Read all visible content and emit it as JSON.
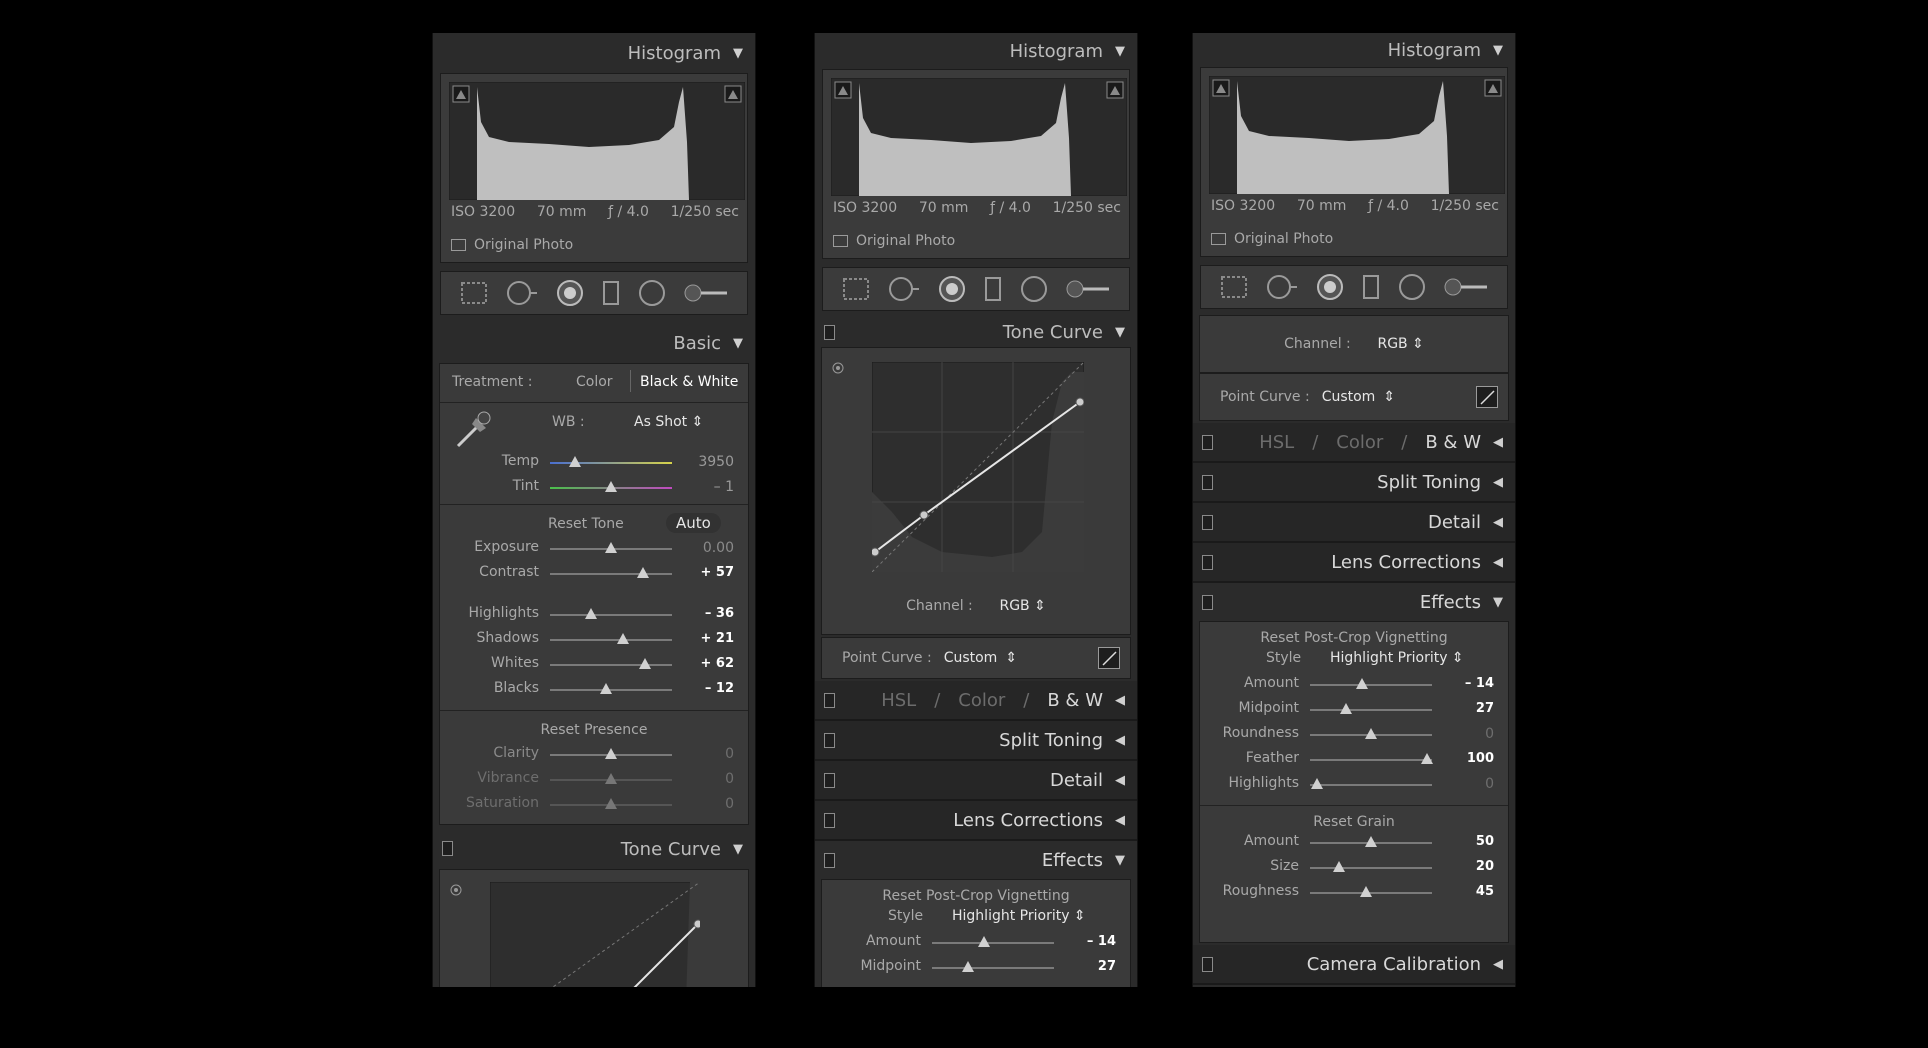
{
  "histogram": {
    "title": "Histogram",
    "iso": "ISO 3200",
    "focal": "70 mm",
    "aperture": "ƒ / 4.0",
    "shutter": "1/250 sec",
    "original": "Original Photo"
  },
  "basic": {
    "title": "Basic",
    "treatment_label": "Treatment :",
    "treatment_color": "Color",
    "treatment_bw": "Black & White",
    "wb_label": "WB :",
    "wb_value": "As Shot",
    "temp": {
      "label": "Temp",
      "value": "3950",
      "pos": 0.23
    },
    "tint": {
      "label": "Tint",
      "value": "– 1",
      "pos": 0.5
    },
    "reset_tone": "Reset Tone",
    "auto": "Auto",
    "exposure": {
      "label": "Exposure",
      "value": "0.00",
      "pos": 0.5
    },
    "contrast": {
      "label": "Contrast",
      "value": "+ 57",
      "pos": 0.76
    },
    "highlights": {
      "label": "Highlights",
      "value": "– 36",
      "pos": 0.34
    },
    "shadows": {
      "label": "Shadows",
      "value": "+ 21",
      "pos": 0.6
    },
    "whites": {
      "label": "Whites",
      "value": "+ 62",
      "pos": 0.78
    },
    "blacks": {
      "label": "Blacks",
      "value": "– 12",
      "pos": 0.46
    },
    "reset_presence": "Reset Presence",
    "clarity": {
      "label": "Clarity",
      "value": "0",
      "pos": 0.5
    },
    "vibrance": {
      "label": "Vibrance",
      "value": "0",
      "pos": 0.5
    },
    "saturation": {
      "label": "Saturation",
      "value": "0",
      "pos": 0.5
    }
  },
  "tone_curve": {
    "title": "Tone Curve",
    "channel_label": "Channel :",
    "channel_value": "RGB",
    "point_label": "Point Curve :",
    "point_value": "Custom"
  },
  "hsl": {
    "hsl": "HSL",
    "color": "Color",
    "bw": "B & W",
    "sep": "/"
  },
  "panels": {
    "split": "Split Toning",
    "detail": "Detail",
    "lens": "Lens Corrections",
    "effects": "Effects",
    "calibration": "Camera Calibration"
  },
  "effects": {
    "reset_vignette": "Reset Post-Crop Vignetting",
    "style_label": "Style",
    "style_value": "Highlight Priority",
    "amount": {
      "label": "Amount",
      "value": "– 14",
      "pos": 0.43
    },
    "midpoint": {
      "label": "Midpoint",
      "value": "27",
      "pos": 0.3
    },
    "roundness": {
      "label": "Roundness",
      "value": "0",
      "pos": 0.5
    },
    "feather": {
      "label": "Feather",
      "value": "100",
      "pos": 0.96
    },
    "highlights": {
      "label": "Highlights",
      "value": "0",
      "pos": 0.06
    },
    "reset_grain": "Reset Grain",
    "grain_amount": {
      "label": "Amount",
      "value": "50",
      "pos": 0.5
    },
    "grain_size": {
      "label": "Size",
      "value": "20",
      "pos": 0.24
    },
    "grain_roughness": {
      "label": "Roughness",
      "value": "45",
      "pos": 0.46
    }
  },
  "colors": {
    "bg": "#2b2b2b",
    "panel": "#3a3a3a",
    "text": "#a9a9a9",
    "bright": "#ffffff"
  }
}
